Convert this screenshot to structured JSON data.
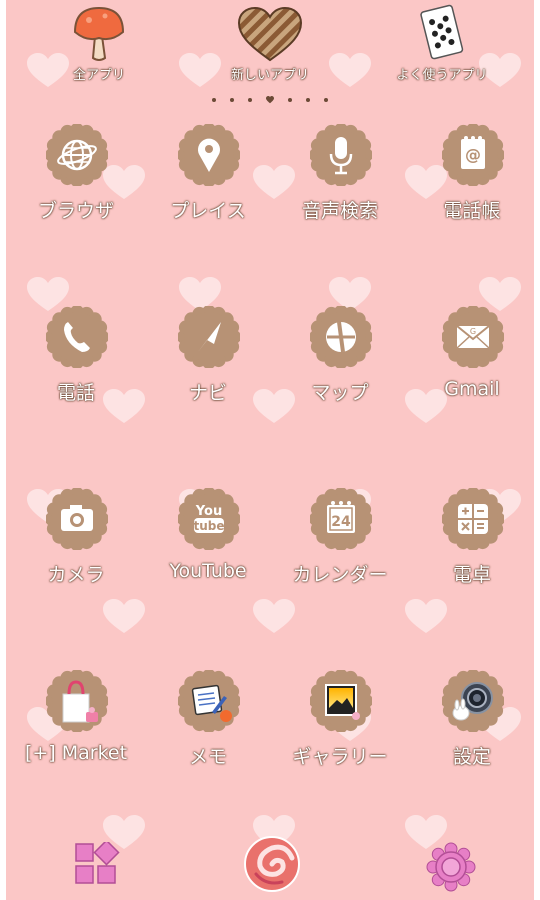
{
  "colors": {
    "background": "#fbc7c6",
    "badge": "#b79275",
    "badge_dark": "#8a6a52",
    "heart": "#fde3e3",
    "label_outline": "#6b4a36"
  },
  "top_bar": {
    "all_apps": {
      "label": "全アプリ",
      "icon": "mushroom-icon"
    },
    "new_apps": {
      "label": "新しいアプリ",
      "icon": "chocolate-heart-icon"
    },
    "frequent_apps": {
      "label": "よく使うアプリ",
      "icon": "playing-card-icon"
    }
  },
  "page_indicator": {
    "count": 7,
    "current_index": 3
  },
  "apps": [
    {
      "label": "ブラウザ",
      "icon": "globe-icon"
    },
    {
      "label": "プレイス",
      "icon": "map-pin-icon"
    },
    {
      "label": "音声検索",
      "icon": "microphone-icon"
    },
    {
      "label": "電話帳",
      "icon": "contacts-icon"
    },
    {
      "label": "電話",
      "icon": "phone-icon"
    },
    {
      "label": "ナビ",
      "icon": "navigation-arrow-icon"
    },
    {
      "label": "マップ",
      "icon": "map-icon"
    },
    {
      "label": "Gmail",
      "icon": "mail-icon"
    },
    {
      "label": "カメラ",
      "icon": "camera-icon"
    },
    {
      "label": "YouTube",
      "icon": "youtube-icon",
      "icon_text": [
        "You",
        "tube"
      ]
    },
    {
      "label": "カレンダー",
      "icon": "calendar-icon",
      "icon_text": "24"
    },
    {
      "label": "電卓",
      "icon": "calculator-icon"
    },
    {
      "label": "[+] Market",
      "icon": "shopping-bag-icon"
    },
    {
      "label": "メモ",
      "icon": "memo-icon"
    },
    {
      "label": "ギャラリー",
      "icon": "gallery-icon"
    },
    {
      "label": "設定",
      "icon": "settings-icon"
    }
  ],
  "dock": {
    "left": {
      "icon": "app-drawer-icon"
    },
    "center": {
      "icon": "home-swirl-icon"
    },
    "right": {
      "icon": "flower-icon"
    }
  }
}
